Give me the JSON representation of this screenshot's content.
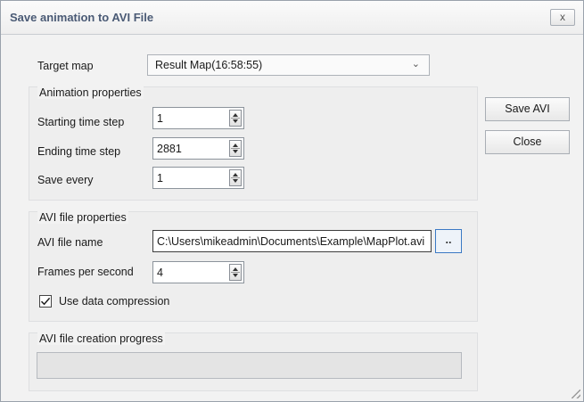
{
  "window": {
    "title": "Save animation to AVI File",
    "close_glyph": "x"
  },
  "target_map": {
    "label": "Target map",
    "value": "Result Map(16:58:55)"
  },
  "animation": {
    "title": "Animation properties",
    "start_label": "Starting time step",
    "start_value": "1",
    "end_label": "Ending time step",
    "end_value": "2881",
    "every_label": "Save every",
    "every_value": "1"
  },
  "avi": {
    "title": "AVI file properties",
    "name_label": "AVI file name",
    "name_value": "C:\\Users\\mikeadmin\\Documents\\Example\\MapPlot.avi",
    "browse_label": "..",
    "fps_label": "Frames per second",
    "fps_value": "4",
    "compression_label": "Use data compression",
    "compression_checked": true
  },
  "progress": {
    "title": "AVI file creation progress",
    "value": 0
  },
  "buttons": {
    "save": "Save AVI",
    "close": "Close"
  },
  "colors": {
    "accent": "#3b79c4",
    "title_text": "#4a5a75"
  }
}
